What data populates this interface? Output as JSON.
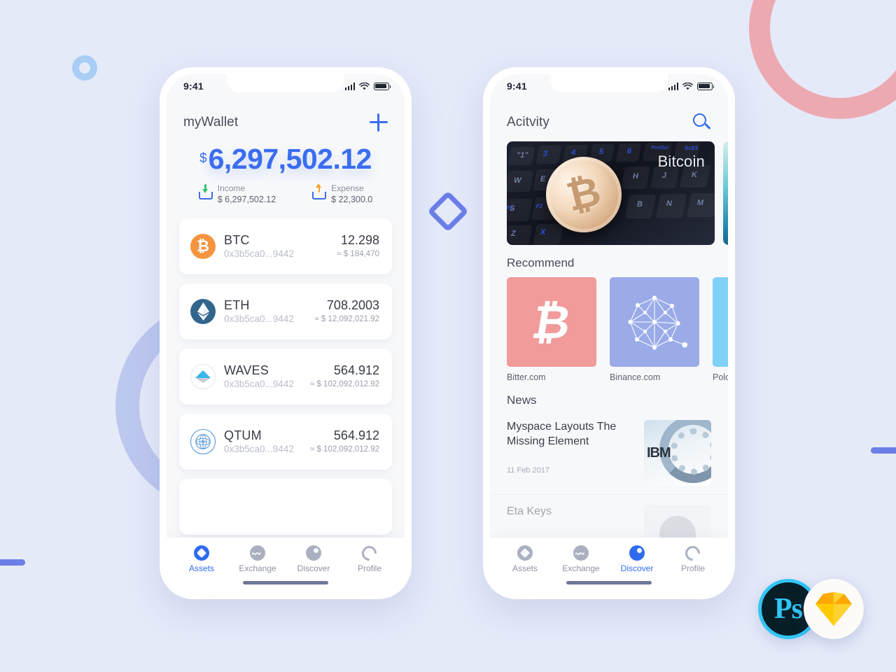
{
  "background": {
    "color": "#e5eaf9",
    "shapes": [
      {
        "name": "pink-arc",
        "color": "#eda9b2"
      },
      {
        "name": "periwinkle-ring",
        "color": "#bdc8ef"
      },
      {
        "name": "small-blue-ring",
        "color": "#a9cdf5"
      },
      {
        "name": "blue-bar-left",
        "color": "#6b7ee8"
      },
      {
        "name": "blue-bar-right",
        "color": "#6b7ee8"
      },
      {
        "name": "blue-diamond",
        "color": "#6b7ee8"
      }
    ]
  },
  "accent": "#3a6df0",
  "wallet_screen": {
    "status": {
      "time": "9:41"
    },
    "header": {
      "title": "myWallet",
      "add_label": "+"
    },
    "balance": {
      "currency_symbol": "$",
      "amount": "6,297,502.12",
      "income": {
        "label": "Income",
        "value": "$ 6,297,502.12",
        "arrow_color": "#35c26a"
      },
      "expense": {
        "label": "Expense",
        "value": "$ 22,300.0",
        "arrow_color": "#f5a623"
      }
    },
    "assets": [
      {
        "symbol": "BTC",
        "glyph": "Ƀ",
        "address": "0x3b5ca0...9442",
        "amount": "12.298",
        "fiat": "≈ $ 184,470",
        "color": "#f5943e"
      },
      {
        "symbol": "ETH",
        "glyph": "◆",
        "address": "0x3b5ca0...9442",
        "amount": "708.2003",
        "fiat": "≈ $ 12,092,021.92",
        "color": "#32658c"
      },
      {
        "symbol": "WAVES",
        "glyph": "▲",
        "address": "0x3b5ca0...9442",
        "amount": "564.912",
        "fiat": "≈ $ 102,092,012.92",
        "color": "#37b6e9"
      },
      {
        "symbol": "QTUM",
        "glyph": "⊕",
        "address": "0x3b5ca0...9442",
        "amount": "564.912",
        "fiat": "≈ $ 102,092,012.92",
        "color": "#4a90d9"
      }
    ],
    "tabs": [
      {
        "label": "Assets",
        "icon": "assets-diamond-icon",
        "active": true
      },
      {
        "label": "Exchange",
        "icon": "exchange-wave-icon",
        "active": false
      },
      {
        "label": "Discover",
        "icon": "discover-dot-icon",
        "active": false
      },
      {
        "label": "Profile",
        "icon": "profile-person-icon",
        "active": false
      }
    ]
  },
  "discover_screen": {
    "status": {
      "time": "9:41"
    },
    "header": {
      "title": "Acitvity",
      "search_icon": "search-icon"
    },
    "banners": [
      {
        "label": "Bitcoin",
        "kind": "bitcoin-keyboard-photo"
      },
      {
        "label": "",
        "kind": "teal-abstract-photo"
      }
    ],
    "recommend": {
      "title": "Recommend",
      "items": [
        {
          "caption": "Bitter.com",
          "color": "#f19b9b",
          "icon": "bitcoin-b-icon"
        },
        {
          "caption": "Binance.com",
          "color": "#9aabe8",
          "icon": "network-graph-icon"
        },
        {
          "caption": "Poloniex.com",
          "color": "#7fd2f5",
          "icon": "poloniex-icon"
        }
      ]
    },
    "news": {
      "title": "News",
      "items": [
        {
          "title": "Myspace Layouts The Missing Element",
          "date": "11 Feb 2017",
          "thumb": "ibm-server-photo"
        },
        {
          "title": "Eta Keys",
          "date": "",
          "thumb": "person-photo"
        }
      ]
    },
    "tabs": [
      {
        "label": "Assets",
        "icon": "assets-diamond-icon",
        "active": false
      },
      {
        "label": "Exchange",
        "icon": "exchange-wave-icon",
        "active": false
      },
      {
        "label": "Discover",
        "icon": "discover-dot-icon",
        "active": true
      },
      {
        "label": "Profile",
        "icon": "profile-person-icon",
        "active": false
      }
    ]
  },
  "badges": [
    {
      "name": "photoshop-logo",
      "text": "Ps",
      "ring": "#31c5f4",
      "fill": "#061e26"
    },
    {
      "name": "sketch-logo",
      "text": "",
      "fill": "#fdb300"
    }
  ]
}
